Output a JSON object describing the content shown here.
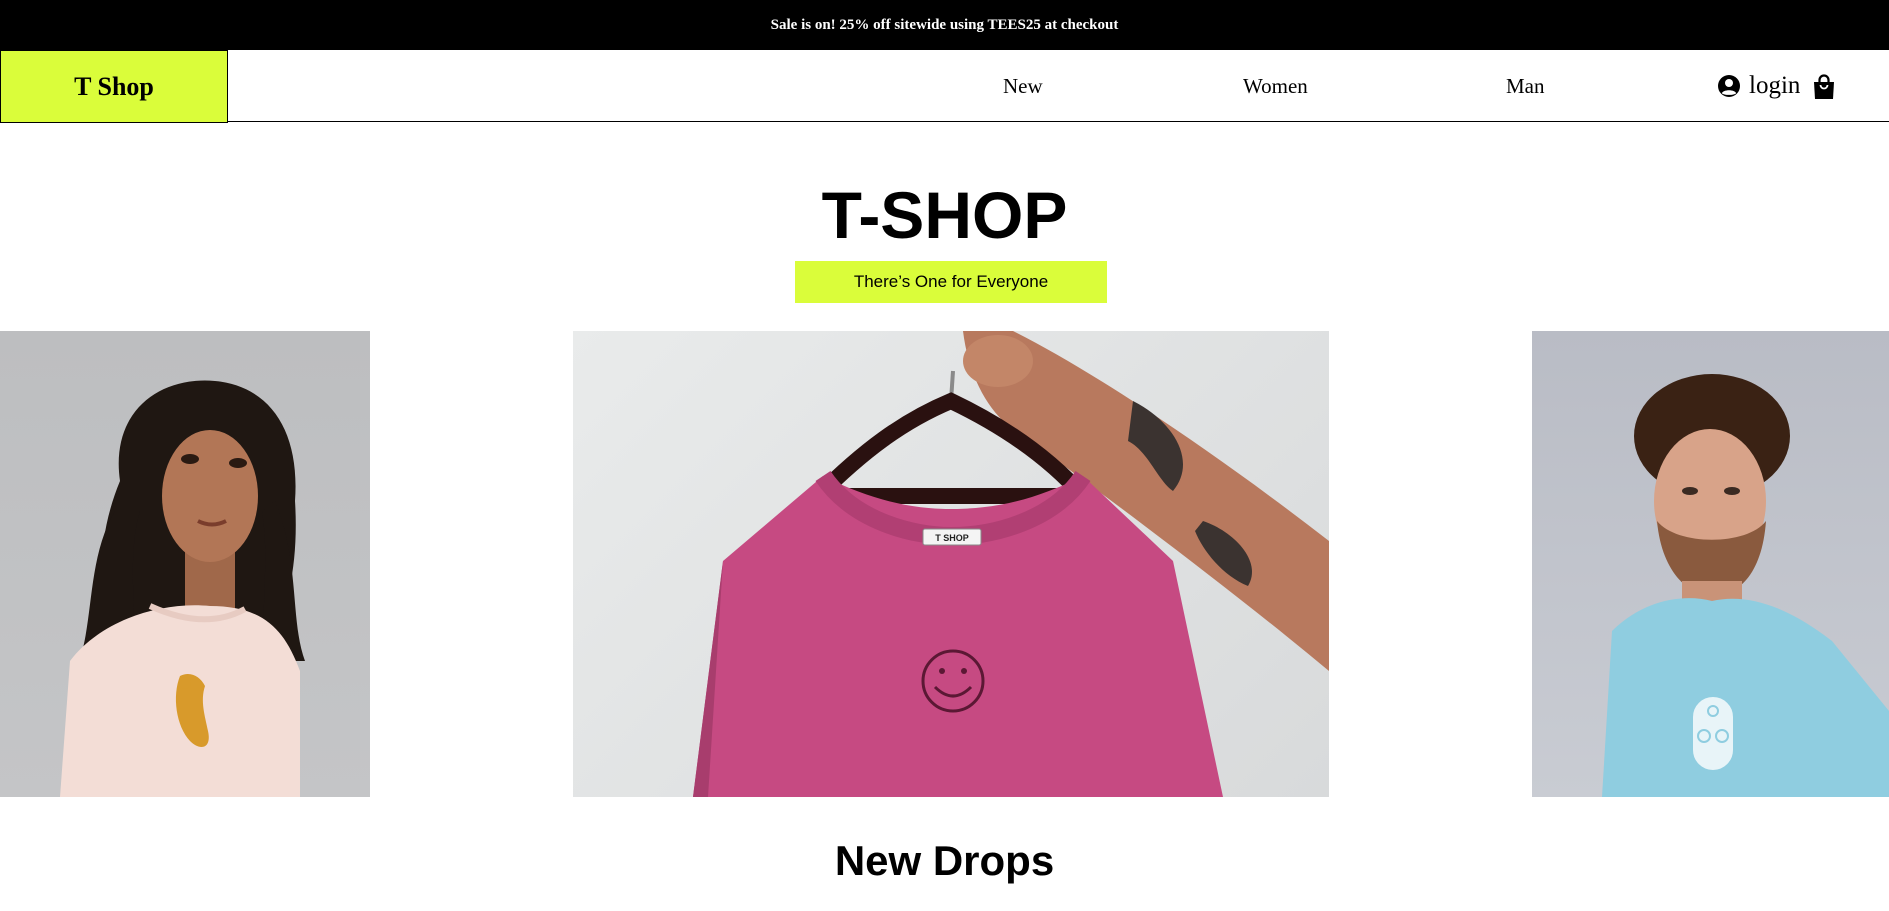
{
  "promo": {
    "text": "Sale is on! 25% off sitewide using TEES25 at checkout"
  },
  "header": {
    "logo": "T Shop",
    "nav": [
      {
        "label": "New"
      },
      {
        "label": "Women"
      },
      {
        "label": "Man"
      }
    ],
    "login_label": "login",
    "icons": {
      "user": "user-circle-icon",
      "cart": "shopping-bag-icon"
    }
  },
  "hero": {
    "title": "T-SHOP",
    "tagline": "There’s One for Everyone",
    "label_tag": "T SHOP",
    "images": [
      {
        "alt": "woman wearing pale pink tee with leopard print"
      },
      {
        "alt": "magenta tee with smiley face on hanger"
      },
      {
        "alt": "man wearing light blue tee with bicycle badge"
      }
    ]
  },
  "sections": {
    "new_drops": "New Drops"
  },
  "colors": {
    "accent": "#dafd3a",
    "promo_bg": "#000000",
    "text": "#000000"
  }
}
